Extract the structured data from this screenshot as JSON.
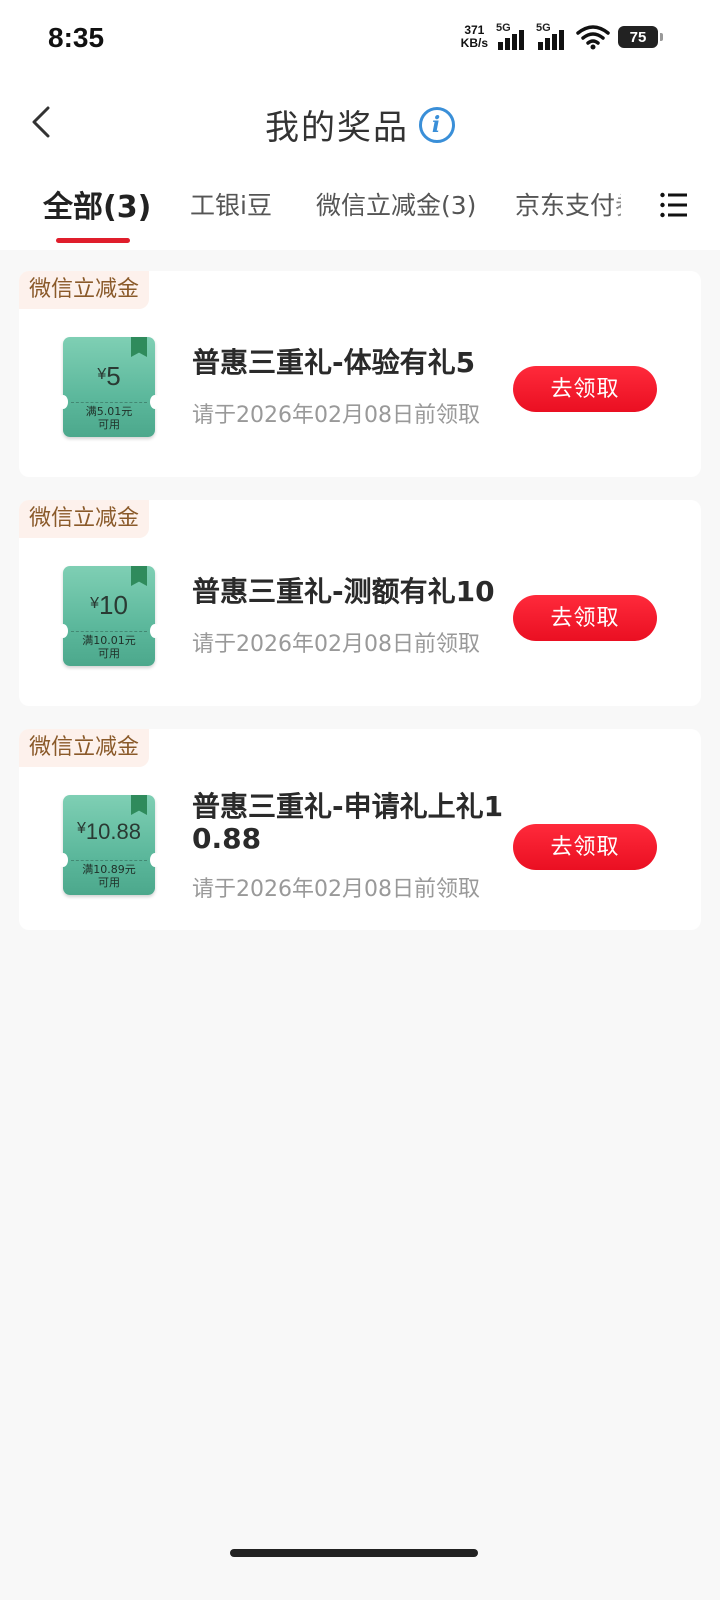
{
  "status_bar": {
    "time": "8:35",
    "net_speed_value": "371",
    "net_speed_unit": "KB/s",
    "signal_1_tag": "5G",
    "signal_2_tag": "5G",
    "wifi_icon": "wifi-icon",
    "battery_level": "75"
  },
  "header": {
    "title": "我的奖品",
    "back_icon": "chevron-left-icon",
    "info_icon": "info-icon",
    "info_glyph": "i"
  },
  "tabs": [
    {
      "label": "全部(3)",
      "active": true
    },
    {
      "label": "工银i豆",
      "active": false
    },
    {
      "label": "微信立减金(3)",
      "active": false
    },
    {
      "label": "京东支付券",
      "active": false
    }
  ],
  "tabs_menu_icon": "list-menu-icon",
  "prizes": [
    {
      "category": "微信立减金",
      "coupon_yen": "¥",
      "coupon_amount": "5",
      "coupon_condition_1": "满5.01元",
      "coupon_condition_2": "可用",
      "title": "普惠三重礼-体验有礼5",
      "deadline": "请于2026年02月08日前领取",
      "action": "去领取"
    },
    {
      "category": "微信立减金",
      "coupon_yen": "¥",
      "coupon_amount": "10",
      "coupon_condition_1": "满10.01元",
      "coupon_condition_2": "可用",
      "title": "普惠三重礼-测额有礼10",
      "deadline": "请于2026年02月08日前领取",
      "action": "去领取"
    },
    {
      "category": "微信立减金",
      "coupon_yen": "¥",
      "coupon_amount": "10.88",
      "coupon_condition_1": "满10.89元",
      "coupon_condition_2": "可用",
      "title": "普惠三重礼-申请礼上礼10.88",
      "deadline": "请于2026年02月08日前领取",
      "action": "去领取"
    }
  ],
  "colors": {
    "accent_red": "#e01e2c",
    "coupon_green": "#5cb89c",
    "info_blue": "#3a8fd8",
    "tag_brown": "#8a5a2a"
  }
}
